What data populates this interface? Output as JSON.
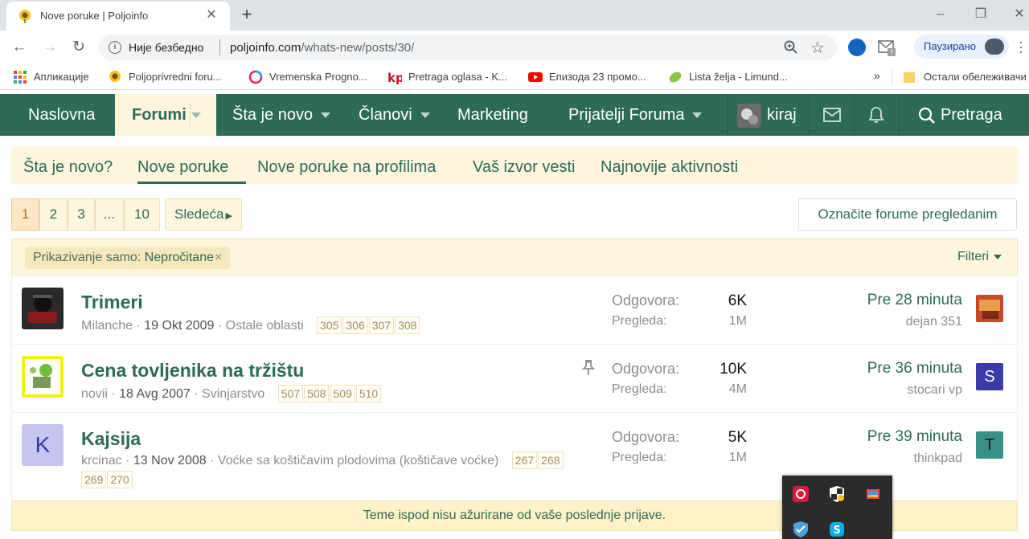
{
  "browser": {
    "tab_title": "Nove poruke | Poljoinfo",
    "security_label": "Није безбедно",
    "url_host": "poljoinfo.com",
    "url_path": "/whats-new/posts/30/",
    "profile_label": "Паузирано",
    "bookmarks": [
      {
        "label": "Апликације",
        "icon": "apps-grid-icon"
      },
      {
        "label": "Poljoprivredni foru...",
        "icon": "sunflower-icon"
      },
      {
        "label": "Vremenska Progno...",
        "icon": "weather-ring-icon"
      },
      {
        "label": "Pretraga oglasa - K...",
        "icon": "kp-logo-icon"
      },
      {
        "label": "Епизода 23 промо...",
        "icon": "youtube-icon"
      },
      {
        "label": "Lista želja - Limund...",
        "icon": "leaf-icon"
      }
    ],
    "bookmarks_overflow": "»",
    "other_bookmarks": "Остали обележивачи"
  },
  "site_nav": {
    "items": [
      "Naslovna",
      "Forumi",
      "Šta je novo",
      "Članovi",
      "Marketing",
      "Prijatelji Foruma"
    ],
    "active": "Forumi",
    "username": "kiraj",
    "search_label": "Pretraga"
  },
  "sub_nav": {
    "items": [
      "Šta je novo?",
      "Nove poruke",
      "Nove poruke na profilima",
      "Vaš izvor vesti",
      "Najnovije aktivnosti"
    ],
    "active": "Nove poruke"
  },
  "pagination": {
    "pages": [
      "1",
      "2",
      "3",
      "...",
      "10"
    ],
    "current": "1",
    "next_label": "Sledeća"
  },
  "mark_read_label": "Označite forume pregledanim",
  "filter": {
    "prefix": "Prikazivanje samo: ",
    "value": "Nepročitane",
    "remove": "×",
    "filters_label": "Filteri"
  },
  "threads": [
    {
      "title": "Trimeri",
      "author": "Milanche",
      "date": "19 Okt 2009",
      "forum": "Ostale oblasti",
      "pages": [
        "305",
        "306",
        "307",
        "308"
      ],
      "replies_label": "Odgovora:",
      "replies": "6K",
      "views_label": "Pregleda:",
      "views": "1M",
      "last_time": "Pre 28 minuta",
      "last_user": "dejan 351",
      "last_avatar_letter": "",
      "pinned": false
    },
    {
      "title": "Cena tovljenika na tržištu",
      "author": "novii",
      "date": "18 Avg 2007",
      "forum": "Svinjarstvo",
      "pages": [
        "507",
        "508",
        "509",
        "510"
      ],
      "replies_label": "Odgovora:",
      "replies": "10K",
      "views_label": "Pregleda:",
      "views": "4M",
      "last_time": "Pre 36 minuta",
      "last_user": "stocari vp",
      "last_avatar_letter": "S",
      "pinned": true
    },
    {
      "title": "Kajsija",
      "author": "krcinac",
      "date": "13 Nov 2008",
      "forum": "Voćke sa koštičavim plodovima (koštičave voćke)",
      "pages": [
        "267",
        "268",
        "269",
        "270"
      ],
      "replies_label": "Odgovora:",
      "replies": "5K",
      "views_label": "Pregleda:",
      "views": "1M",
      "last_time": "Pre 39 minuta",
      "last_user": "thinkpad",
      "last_avatar_letter": "T",
      "author_avatar_letter": "K",
      "pinned": false
    }
  ],
  "unread_notice": "Teme ispod nisu ažurirane od vaše poslednje prijave.",
  "colors": {
    "brand_green": "#2d6a57",
    "cream": "#fdf6dc",
    "avatar_s": "#3a3aa8",
    "avatar_t": "#3a8f86",
    "avatar_k": "#c5c5f0"
  }
}
